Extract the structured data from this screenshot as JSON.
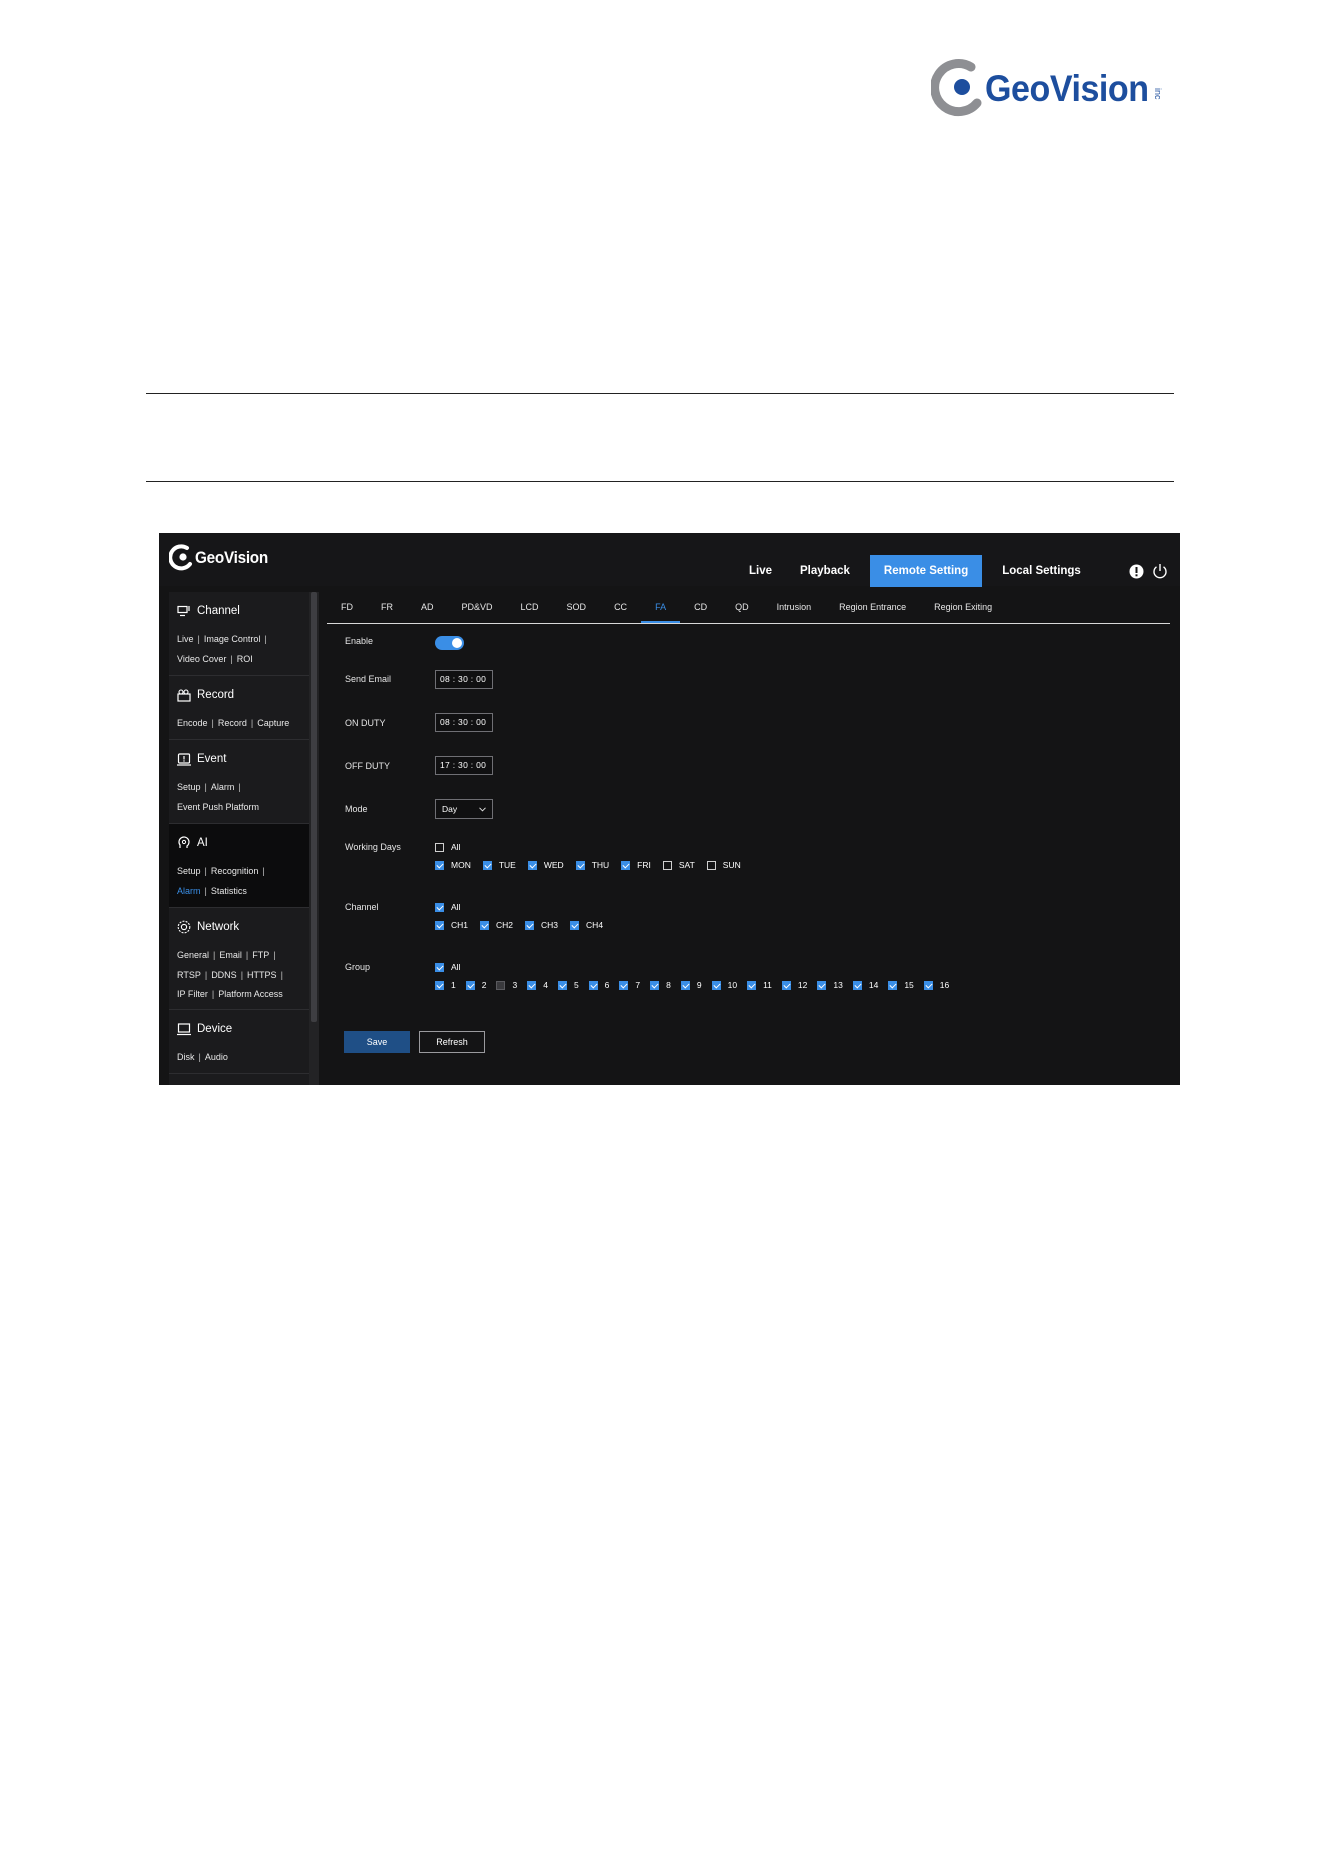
{
  "document": {
    "brand": "GeoVision",
    "brand_suffix": "inc"
  },
  "app": {
    "brand": "GeoVision",
    "nav": [
      {
        "label": "Live",
        "active": false
      },
      {
        "label": "Playback",
        "active": false
      },
      {
        "label": "Remote Setting",
        "active": true
      },
      {
        "label": "Local Settings",
        "active": false
      }
    ],
    "icons": [
      "alert-icon",
      "power-icon"
    ]
  },
  "sidebar": {
    "sections": [
      {
        "title": "Channel",
        "icon": "channel-icon",
        "active": false,
        "lines": [
          [
            "Live",
            "Image Control"
          ],
          [
            "Video Cover",
            "ROI"
          ]
        ]
      },
      {
        "title": "Record",
        "icon": "record-icon",
        "active": false,
        "lines": [
          [
            "Encode",
            "Record",
            "Capture"
          ]
        ]
      },
      {
        "title": "Event",
        "icon": "event-icon",
        "active": false,
        "lines": [
          [
            "Setup",
            "Alarm"
          ],
          [
            "Event Push Platform"
          ]
        ]
      },
      {
        "title": "AI",
        "icon": "ai-icon",
        "active": true,
        "lines": [
          [
            "Setup",
            "Recognition"
          ],
          [
            "Alarm",
            "Statistics"
          ]
        ],
        "active_link": "Alarm"
      },
      {
        "title": "Network",
        "icon": "network-icon",
        "active": false,
        "lines": [
          [
            "General",
            "Email",
            "FTP"
          ],
          [
            "RTSP",
            "DDNS",
            "HTTPS"
          ],
          [
            "IP Filter",
            "Platform Access"
          ]
        ]
      },
      {
        "title": "Device",
        "icon": "device-icon",
        "active": false,
        "lines": [
          [
            "Disk",
            "Audio"
          ]
        ]
      }
    ]
  },
  "tabs": [
    "FD",
    "FR",
    "AD",
    "PD&VD",
    "LCD",
    "SOD",
    "CC",
    "FA",
    "CD",
    "QD",
    "Intrusion",
    "Region Entrance",
    "Region Exiting"
  ],
  "active_tab": "FA",
  "form": {
    "enable": {
      "label": "Enable",
      "on": true
    },
    "send_email": {
      "label": "Send Email",
      "value": "08 : 30 : 00"
    },
    "on_duty": {
      "label": "ON DUTY",
      "value": "08 : 30 : 00"
    },
    "off_duty": {
      "label": "OFF DUTY",
      "value": "17 : 30 : 00"
    },
    "mode": {
      "label": "Mode",
      "value": "Day"
    },
    "working_days": {
      "label": "Working Days",
      "all": {
        "label": "All",
        "checked": false
      },
      "items": [
        {
          "label": "MON",
          "checked": true
        },
        {
          "label": "TUE",
          "checked": true
        },
        {
          "label": "WED",
          "checked": true
        },
        {
          "label": "THU",
          "checked": true
        },
        {
          "label": "FRI",
          "checked": true
        },
        {
          "label": "SAT",
          "checked": false
        },
        {
          "label": "SUN",
          "checked": false
        }
      ]
    },
    "channel": {
      "label": "Channel",
      "all": {
        "label": "All",
        "checked": true
      },
      "items": [
        {
          "label": "CH1",
          "checked": true
        },
        {
          "label": "CH2",
          "checked": true
        },
        {
          "label": "CH3",
          "checked": true
        },
        {
          "label": "CH4",
          "checked": true
        }
      ]
    },
    "group": {
      "label": "Group",
      "all": {
        "label": "All",
        "checked": true
      },
      "items": [
        {
          "label": "1",
          "checked": true
        },
        {
          "label": "2",
          "checked": true
        },
        {
          "label": "3",
          "checked": false
        },
        {
          "label": "4",
          "checked": true
        },
        {
          "label": "5",
          "checked": true
        },
        {
          "label": "6",
          "checked": true
        },
        {
          "label": "7",
          "checked": true
        },
        {
          "label": "8",
          "checked": true
        },
        {
          "label": "9",
          "checked": true
        },
        {
          "label": "10",
          "checked": true
        },
        {
          "label": "11",
          "checked": true
        },
        {
          "label": "12",
          "checked": true
        },
        {
          "label": "13",
          "checked": true
        },
        {
          "label": "14",
          "checked": true
        },
        {
          "label": "15",
          "checked": true
        },
        {
          "label": "16",
          "checked": true
        }
      ]
    },
    "buttons": {
      "save": "Save",
      "refresh": "Refresh"
    }
  },
  "colors": {
    "accent": "#3a8ee6",
    "save_button": "#1f4f86",
    "logo_blue": "#1d4e9e",
    "panel_bg": "#141415"
  }
}
